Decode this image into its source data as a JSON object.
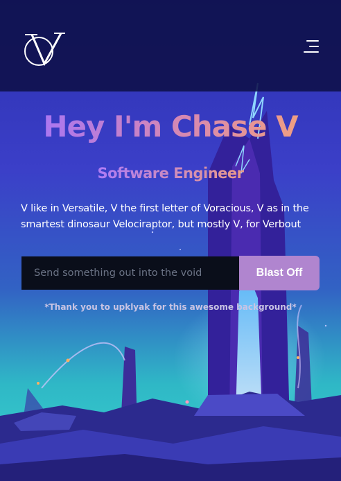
{
  "header": {
    "logo_icon": "cv-monogram-logo",
    "menu_icon": "hamburger-menu-icon"
  },
  "hero": {
    "title": "Hey I'm Chase V",
    "subtitle": "Software Engineer",
    "description": "V like in Versatile, V the first letter of Voracious, V as in the smartest dinosaur Velociraptor, but mostly V, for Verbout"
  },
  "form": {
    "placeholder": "Send something out into the void",
    "value": "",
    "button_label": "Blast Off"
  },
  "credit": "*Thank you to upklyak for this awesome background*",
  "colors": {
    "header_bg": "#0e1048",
    "button_bg": "#b085cf",
    "input_bg": "#0a0e1a",
    "title_gradient_start": "#a875f5",
    "title_gradient_end": "#f1a07f"
  }
}
